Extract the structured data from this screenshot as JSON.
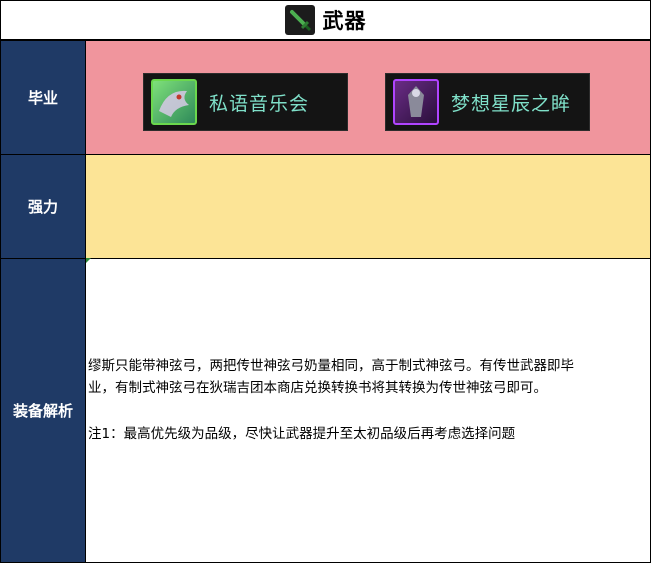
{
  "header": {
    "title": "武器",
    "icon": "sword-icon"
  },
  "rows": {
    "graduate": {
      "label": "毕业",
      "items": [
        {
          "name": "私语音乐会",
          "icon": "dragon-icon"
        },
        {
          "name": "梦想星辰之眸",
          "icon": "armor-icon"
        }
      ],
      "color": "#f0959d"
    },
    "strong": {
      "label": "强力",
      "color": "#fce496"
    },
    "analysis": {
      "label": "装备解析",
      "line1": "缪斯只能带神弦弓，两把传世神弦弓奶量相同，高于制式神弦弓。有传世武器即毕",
      "line2": "业，有制式神弦弓在狄瑞吉团本商店兑换转换书将其转换为传世神弦弓即可。",
      "note": "注1：最高优先级为品级，尽快让武器提升至太初品级后再考虑选择问题"
    }
  },
  "colors": {
    "label_bg": "#1f3a66",
    "item_text": "#7fe0c9"
  }
}
